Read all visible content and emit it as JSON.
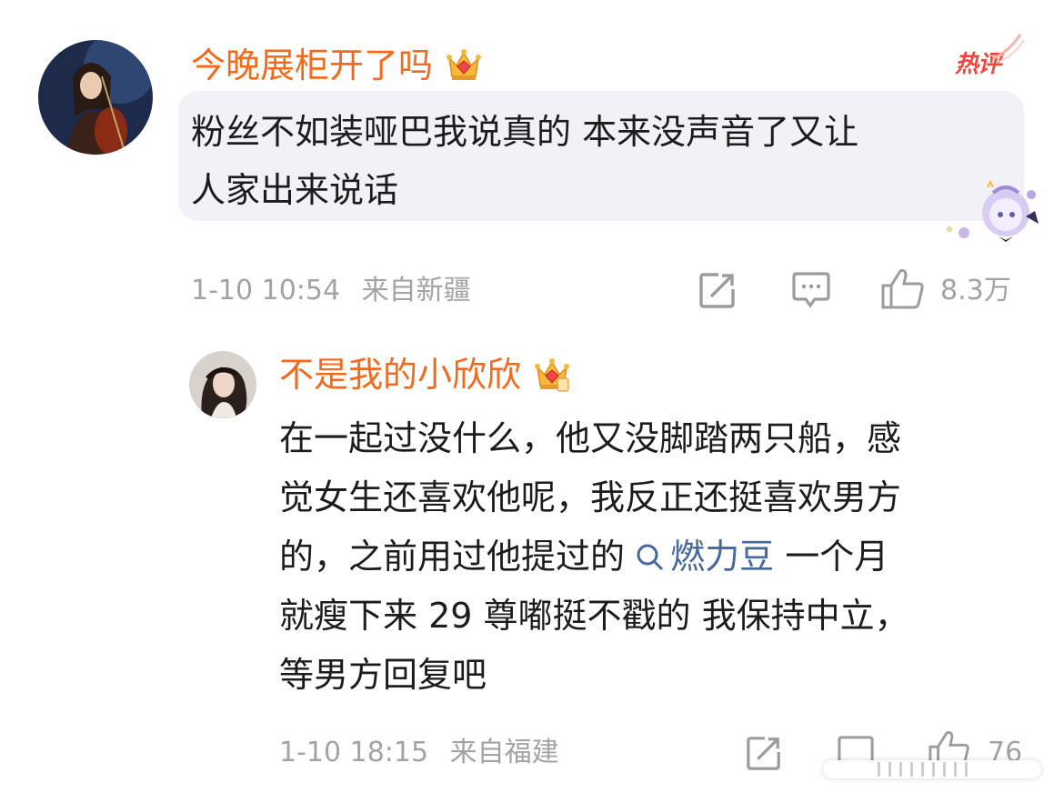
{
  "comment": {
    "username": "今晚展柜开了吗",
    "hot_tag": "热评",
    "text_lines": [
      "粉丝不如装哑巴我说真的 本来没声音了又让",
      "人家出来说话"
    ],
    "time": "1-10 10:54",
    "location": "来自新疆",
    "like_count": "8.3万"
  },
  "reply": {
    "username": "不是我的小欣欣",
    "text_line1": "在一起过没什么，他又没脚踏两只船，感",
    "text_line2": "觉女生还喜欢他呢，我反正还挺喜欢男方",
    "text_line3_before": "的，之前用过他提过的 ",
    "topic": "燃力豆",
    "text_line3_after": " 一个月",
    "text_line4": "就瘦下来 29 尊嘟挺不戳的 我保持中立，",
    "text_line5": "等男方回复吧",
    "time": "1-10 18:15",
    "location": "来自福建",
    "like_count": "76"
  },
  "icons": {
    "repost": "share-square-icon",
    "comment": "comment-bubble-icon",
    "like": "thumbs-up-icon",
    "badge": "crown-gem-icon",
    "topic": "search-icon"
  },
  "colors": {
    "username": "#f26b1d",
    "hot_tag": "#f0463e",
    "link": "#46689a",
    "meta": "#a3a3a3",
    "bubble": "#f2f1f8"
  }
}
